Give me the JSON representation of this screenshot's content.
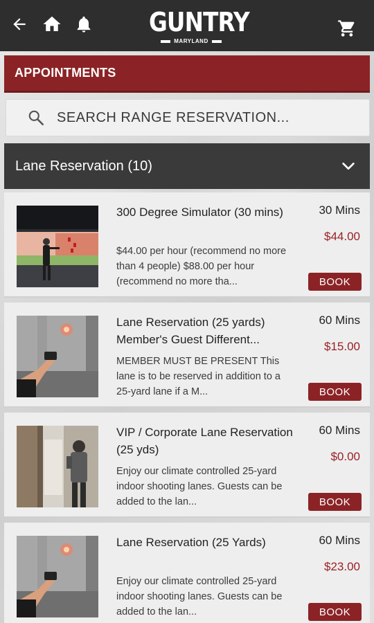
{
  "header": {
    "brand": "GUNTRY",
    "brand_sub": "MARYLAND"
  },
  "section": {
    "title": "APPOINTMENTS"
  },
  "search": {
    "placeholder": "SEARCH RANGE RESERVATION..."
  },
  "category": {
    "label": "Lane Reservation (10)"
  },
  "colors": {
    "accent": "#8b2326",
    "header_bg": "#2e2e2e",
    "category_bg": "#3a3a3a",
    "price": "#9a2024"
  },
  "items": [
    {
      "title": "300 Degree Simulator (30 mins)",
      "description": "$44.00 per hour (recommend no more than 4 people) $88.00 per hour (recommend no more tha...",
      "duration": "30 Mins",
      "price": "$44.00",
      "book_label": "BOOK"
    },
    {
      "title": "Lane Reservation (25 yards) Member's Guest Different...",
      "description": "MEMBER MUST BE PRESENT This lane is to be reserved in addition to a 25-yard lane if a M...",
      "duration": "60 Mins",
      "price": "$15.00",
      "book_label": "BOOK"
    },
    {
      "title": "VIP / Corporate Lane Reservation (25 yds)",
      "description": "Enjoy our climate controlled 25-yard indoor shooting lanes. Guests can be added to the lan...",
      "duration": "60 Mins",
      "price": "$0.00",
      "book_label": "BOOK"
    },
    {
      "title": "Lane Reservation (25 Yards)",
      "description": "Enjoy our climate controlled 25-yard indoor shooting lanes. Guests can be added to the lan...",
      "duration": "60 Mins",
      "price": "$23.00",
      "book_label": "BOOK"
    }
  ]
}
